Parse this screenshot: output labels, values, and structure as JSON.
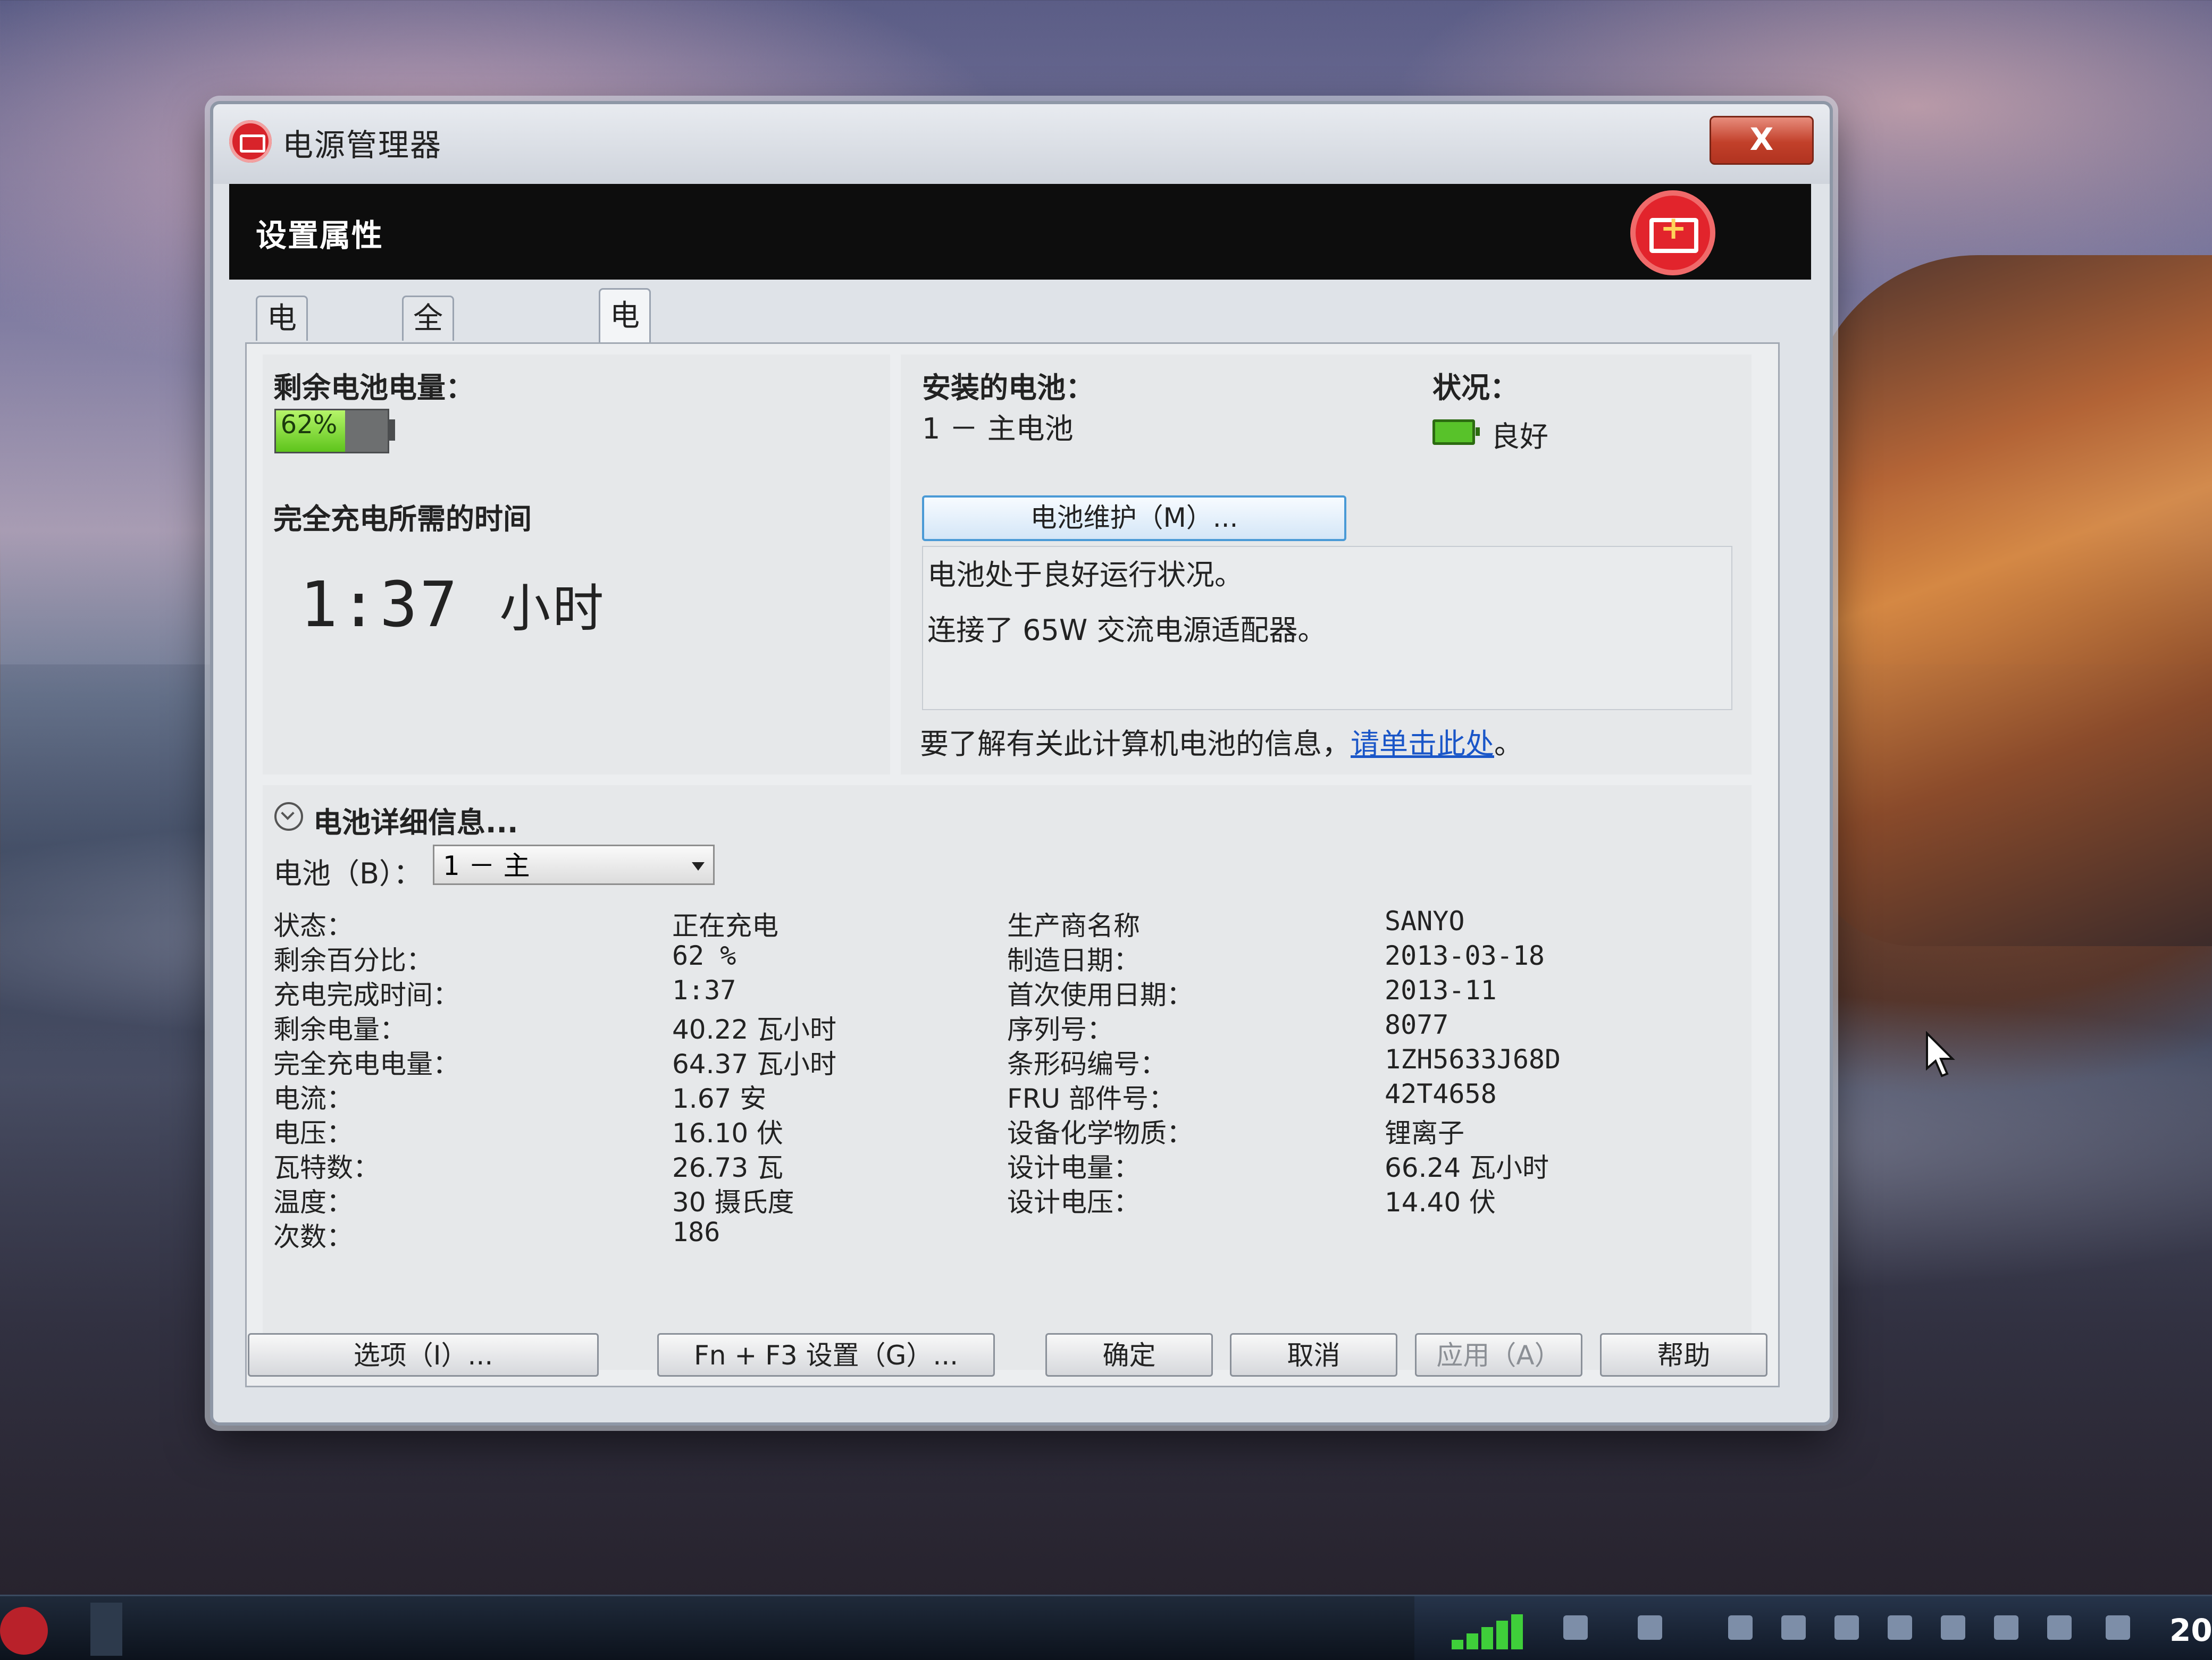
{
  "window": {
    "title": "电源管理器",
    "close_label": "X",
    "header_title": "设置属性"
  },
  "tabs": [
    {
      "label": "电源方案"
    },
    {
      "label": "全局电源设置"
    },
    {
      "label": "电池信息"
    }
  ],
  "battery_info": {
    "remaining_label": "剩余电池电量：",
    "remaining_percent": "62%",
    "remaining_fraction": 0.62,
    "charge_time_label": "完全充电所需的时间",
    "charge_time_value": "1:37",
    "charge_time_unit": "小时",
    "installed_label": "安装的电池：",
    "installed_value": "1 － 主电池",
    "status_label": "状况：",
    "status_value": "良好",
    "maintenance_button": "电池维护（M）...",
    "message_1": "电池处于良好运行状况。",
    "message_2": "连接了 65W 交流电源适配器。",
    "info_text": "要了解有关此计算机电池的信息，",
    "info_link": "请单击此处",
    "info_suffix": "。"
  },
  "details": {
    "section_title": "电池详细信息...",
    "battery_select_label": "电池（B）：",
    "battery_select_value": "1 － 主",
    "left_rows": [
      {
        "label": "状态：",
        "value": "正在充电"
      },
      {
        "label": "剩余百分比：",
        "value": "62 %"
      },
      {
        "label": "充电完成时间：",
        "value": "1:37"
      },
      {
        "label": "剩余电量：",
        "value": "40.22 瓦小时"
      },
      {
        "label": "完全充电电量：",
        "value": "64.37 瓦小时"
      },
      {
        "label": "电流：",
        "value": "1.67 安"
      },
      {
        "label": "电压：",
        "value": "16.10 伏"
      },
      {
        "label": "瓦特数：",
        "value": "26.73 瓦"
      },
      {
        "label": "温度：",
        "value": "30 摄氏度"
      },
      {
        "label": "次数：",
        "value": "186"
      }
    ],
    "right_rows": [
      {
        "label": "生产商名称",
        "value": "SANYO"
      },
      {
        "label": "制造日期：",
        "value": "2013-03-18"
      },
      {
        "label": "首次使用日期：",
        "value": "2013-11"
      },
      {
        "label": "序列号：",
        "value": "8077"
      },
      {
        "label": "条形码编号：",
        "value": "1ZH5633J68D"
      },
      {
        "label": "FRU 部件号：",
        "value": "42T4658"
      },
      {
        "label": "设备化学物质：",
        "value": "锂离子"
      },
      {
        "label": "设计电量：",
        "value": "66.24 瓦小时"
      },
      {
        "label": "设计电压：",
        "value": "14.40 伏"
      }
    ]
  },
  "buttons": {
    "options": "选项（I）...",
    "fn_f3": "Fn + F3 设置（G）...",
    "ok": "确定",
    "cancel": "取消",
    "apply": "应用（A）",
    "help": "帮助"
  },
  "taskbar": {
    "clock": "20"
  },
  "colors": {
    "header_bg": "#0d0d0d",
    "brand_red": "#e2242c",
    "battery_green": "#5ec41c",
    "link_blue": "#1a56c8"
  }
}
